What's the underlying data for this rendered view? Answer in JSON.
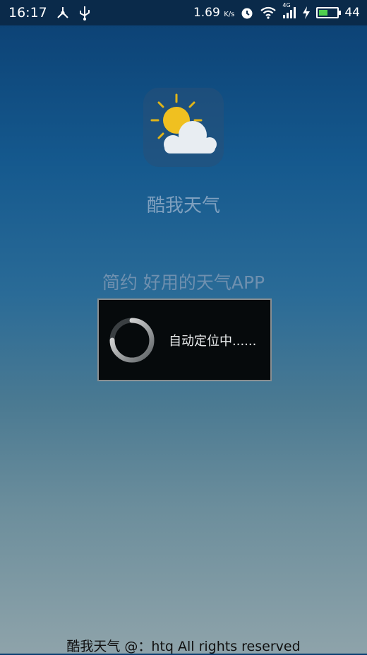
{
  "status_bar": {
    "time": "16:17",
    "network_speed": "1.69",
    "network_speed_unit": "K/s",
    "battery_level": "44",
    "network_type": "4G",
    "icons": [
      "share-icon",
      "usb-icon",
      "alarm-icon",
      "wifi-icon",
      "signal-icon",
      "charging-icon",
      "battery-icon"
    ]
  },
  "splash": {
    "app_name": "酷我天气",
    "slogan": "简约 好用的天气APP",
    "footer": "酷我天气 @：htq All rights reserved",
    "icon": "weather-sun-cloud-icon"
  },
  "dialog": {
    "message": "自动定位中......",
    "icon": "loading-spinner-icon"
  },
  "colors": {
    "status_bar_bg": "#0a2a4a",
    "sun": "#f0c020",
    "cloud": "#e8edf2",
    "dialog_bg": "#060a0c",
    "battery_fill": "#4fd04f"
  }
}
